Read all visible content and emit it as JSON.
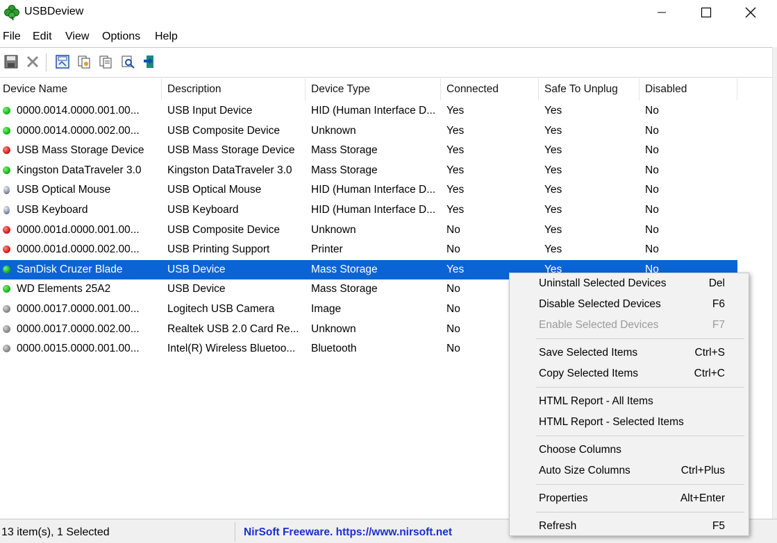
{
  "window": {
    "title": "USBDeview",
    "icon": "clover-app-icon",
    "controls": [
      "minimize-icon",
      "maximize-icon",
      "close-icon"
    ]
  },
  "menu": {
    "items": [
      "File",
      "Edit",
      "View",
      "Options",
      "Help"
    ]
  },
  "toolbar": {
    "buttons": [
      "save-icon",
      "delete-icon",
      "save-html-icon",
      "copy-icon",
      "properties-icon",
      "find-icon",
      "exit-icon"
    ]
  },
  "columns": [
    "Device Name",
    "Description",
    "Device Type",
    "Connected",
    "Safe To Unplug",
    "Disabled"
  ],
  "rows": [
    {
      "status": "green",
      "name": "0000.0014.0000.001.00...",
      "description": "USB Input Device",
      "type": "HID (Human Interface D...",
      "connected": "Yes",
      "safe": "Yes",
      "disabled": "No"
    },
    {
      "status": "green",
      "name": "0000.0014.0000.002.00...",
      "description": "USB Composite Device",
      "type": "Unknown",
      "connected": "Yes",
      "safe": "Yes",
      "disabled": "No"
    },
    {
      "status": "red",
      "name": "USB Mass Storage Device",
      "description": "USB Mass Storage Device",
      "type": "Mass Storage",
      "connected": "Yes",
      "safe": "Yes",
      "disabled": "No"
    },
    {
      "status": "green",
      "name": "Kingston DataTraveler 3.0",
      "description": "Kingston DataTraveler 3.0",
      "type": "Mass Storage",
      "connected": "Yes",
      "safe": "Yes",
      "disabled": "No"
    },
    {
      "status": "mouse",
      "name": "USB Optical Mouse",
      "description": "USB Optical Mouse",
      "type": "HID (Human Interface D...",
      "connected": "Yes",
      "safe": "Yes",
      "disabled": "No"
    },
    {
      "status": "mouse",
      "name": "USB Keyboard",
      "description": "USB Keyboard",
      "type": "HID (Human Interface D...",
      "connected": "Yes",
      "safe": "Yes",
      "disabled": "No"
    },
    {
      "status": "red",
      "name": "0000.001d.0000.001.00...",
      "description": "USB Composite Device",
      "type": "Unknown",
      "connected": "No",
      "safe": "Yes",
      "disabled": "No"
    },
    {
      "status": "red",
      "name": "0000.001d.0000.002.00...",
      "description": "USB Printing Support",
      "type": "Printer",
      "connected": "No",
      "safe": "Yes",
      "disabled": "No"
    },
    {
      "status": "green",
      "name": "SanDisk Cruzer Blade",
      "description": "USB Device",
      "type": "Mass Storage",
      "connected": "Yes",
      "safe": "Yes",
      "disabled": "No",
      "selected": true
    },
    {
      "status": "green",
      "name": "WD Elements 25A2",
      "description": "USB Device",
      "type": "Mass Storage",
      "connected": "No",
      "safe": "",
      "disabled": ""
    },
    {
      "status": "gray",
      "name": "0000.0017.0000.001.00...",
      "description": "Logitech USB Camera",
      "type": "Image",
      "connected": "No",
      "safe": "",
      "disabled": ""
    },
    {
      "status": "gray",
      "name": "0000.0017.0000.002.00...",
      "description": "Realtek USB 2.0 Card Re...",
      "type": "Unknown",
      "connected": "No",
      "safe": "",
      "disabled": ""
    },
    {
      "status": "gray",
      "name": "0000.0015.0000.001.00...",
      "description": "Intel(R) Wireless Bluetoo...",
      "type": "Bluetooth",
      "connected": "No",
      "safe": "",
      "disabled": ""
    }
  ],
  "status": {
    "count": "13 item(s), 1 Selected",
    "link": "NirSoft Freeware.  https://www.nirsoft.net"
  },
  "context_menu": {
    "groups": [
      [
        {
          "label": "Uninstall Selected Devices",
          "shortcut": "Del",
          "enabled": true
        },
        {
          "label": "Disable Selected Devices",
          "shortcut": "F6",
          "enabled": true
        },
        {
          "label": "Enable Selected Devices",
          "shortcut": "F7",
          "enabled": false
        }
      ],
      [
        {
          "label": "Save Selected Items",
          "shortcut": "Ctrl+S",
          "enabled": true
        },
        {
          "label": "Copy Selected Items",
          "shortcut": "Ctrl+C",
          "enabled": true
        }
      ],
      [
        {
          "label": "HTML Report - All Items",
          "shortcut": "",
          "enabled": true
        },
        {
          "label": "HTML Report - Selected Items",
          "shortcut": "",
          "enabled": true
        }
      ],
      [
        {
          "label": "Choose Columns",
          "shortcut": "",
          "enabled": true
        },
        {
          "label": "Auto Size Columns",
          "shortcut": "Ctrl+Plus",
          "enabled": true
        }
      ],
      [
        {
          "label": "Properties",
          "shortcut": "Alt+Enter",
          "enabled": true
        }
      ],
      [
        {
          "label": "Refresh",
          "shortcut": "F5",
          "enabled": true
        }
      ]
    ]
  }
}
